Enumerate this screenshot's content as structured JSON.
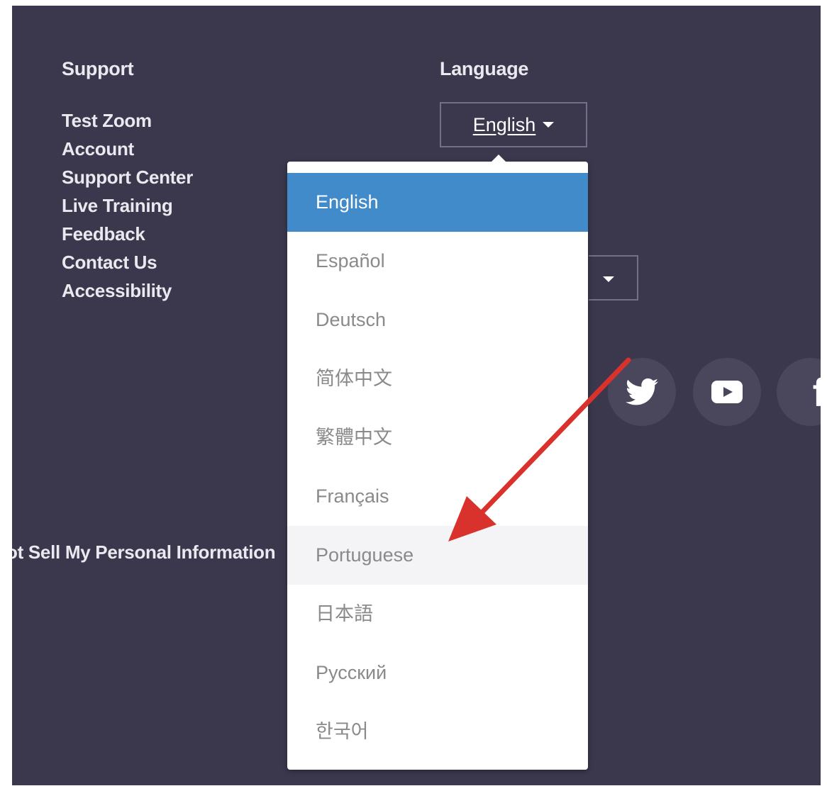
{
  "support": {
    "heading": "Support",
    "links": [
      "Test Zoom",
      "Account",
      "Support Center",
      "Live Training",
      "Feedback",
      "Contact Us",
      "Accessibility"
    ]
  },
  "legal": {
    "do_not_sell": "ot Sell My Personal Information"
  },
  "language": {
    "heading": "Language",
    "selected_label": "English",
    "options": [
      "English",
      "Español",
      "Deutsch",
      "简体中文",
      "繁體中文",
      "Français",
      "Portuguese",
      "日本語",
      "Русский",
      "한국어"
    ],
    "selected_index": 0,
    "hovered_index": 6
  },
  "social": {
    "icons": [
      "twitter-icon",
      "youtube-icon",
      "facebook-icon"
    ],
    "facebook_glyph": "f"
  },
  "colors": {
    "footer_bg": "#3b384d",
    "selected_bg": "#428bca",
    "arrow": "#d9322c"
  }
}
